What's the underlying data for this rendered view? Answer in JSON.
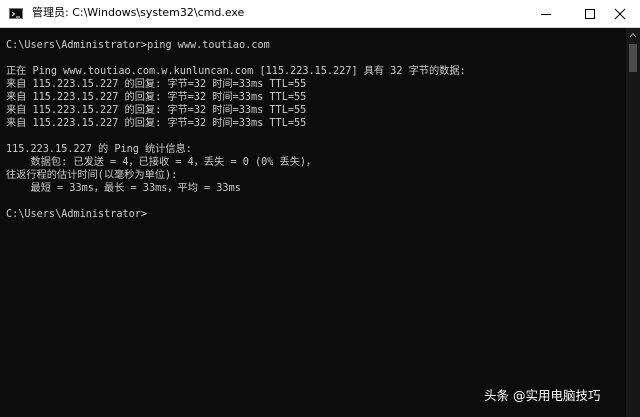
{
  "window": {
    "title": "管理员: C:\\Windows\\system32\\cmd.exe",
    "app_icon": "console-icon",
    "controls": {
      "minimize_icon": "minimize-icon",
      "maximize_icon": "maximize-icon",
      "close_icon": "close-icon"
    }
  },
  "console": {
    "lines": [
      "C:\\Users\\Administrator>ping www.toutiao.com",
      "",
      "正在 Ping www.toutiao.com.w.kunluncan.com [115.223.15.227] 具有 32 字节的数据:",
      "来自 115.223.15.227 的回复: 字节=32 时间=33ms TTL=55",
      "来自 115.223.15.227 的回复: 字节=32 时间=33ms TTL=55",
      "来自 115.223.15.227 的回复: 字节=32 时间=33ms TTL=55",
      "来自 115.223.15.227 的回复: 字节=32 时间=33ms TTL=55",
      "",
      "115.223.15.227 的 Ping 统计信息:",
      "    数据包: 已发送 = 4，已接收 = 4，丢失 = 0 (0% 丢失)，",
      "往返行程的估计时间(以毫秒为单位):",
      "    最短 = 33ms，最长 = 33ms，平均 = 33ms",
      "",
      "C:\\Users\\Administrator>"
    ]
  },
  "watermark": "头条 @实用电脑技巧",
  "colors": {
    "console_bg": "#0c0c0c",
    "console_text": "#cccccc",
    "titlebar_bg": "#ffffff"
  }
}
